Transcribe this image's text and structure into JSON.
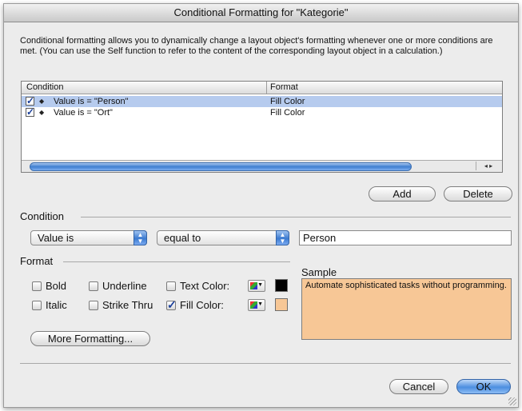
{
  "window": {
    "title": "Conditional Formatting for \"Kategorie\""
  },
  "description": "Conditional formatting allows you to dynamically change a layout object's formatting whenever one or more conditions are met.  (You can use the Self function to refer to the content of the corresponding layout object in a calculation.)",
  "list": {
    "columns": {
      "condition": "Condition",
      "format": "Format"
    },
    "rows": [
      {
        "condition": "Value is = \"Person\"",
        "format": "Fill Color",
        "checked": true,
        "selected": true
      },
      {
        "condition": "Value is = \"Ort\"",
        "format": "Fill Color",
        "checked": true,
        "selected": false
      }
    ],
    "scroll_arrows": "◂ ▸"
  },
  "buttons": {
    "add": "Add",
    "delete": "Delete",
    "more_formatting": "More Formatting...",
    "cancel": "Cancel",
    "ok": "OK"
  },
  "condition_group": {
    "label": "Condition",
    "type_popup": "Value is",
    "operator_popup": "equal to",
    "value": "Person"
  },
  "format_group": {
    "label": "Format",
    "bold": "Bold",
    "italic": "Italic",
    "underline": "Underline",
    "strike_thru": "Strike Thru",
    "text_color": "Text Color:",
    "fill_color": "Fill Color:",
    "text_color_checked": false,
    "fill_color_checked": true,
    "text_color_value": "#000000",
    "fill_color_value": "#f7c796"
  },
  "sample": {
    "label": "Sample",
    "text": "Automate sophisticated tasks without programming."
  },
  "colors": {
    "accent": "#4c8ee0",
    "selection": "#b6cbee"
  }
}
